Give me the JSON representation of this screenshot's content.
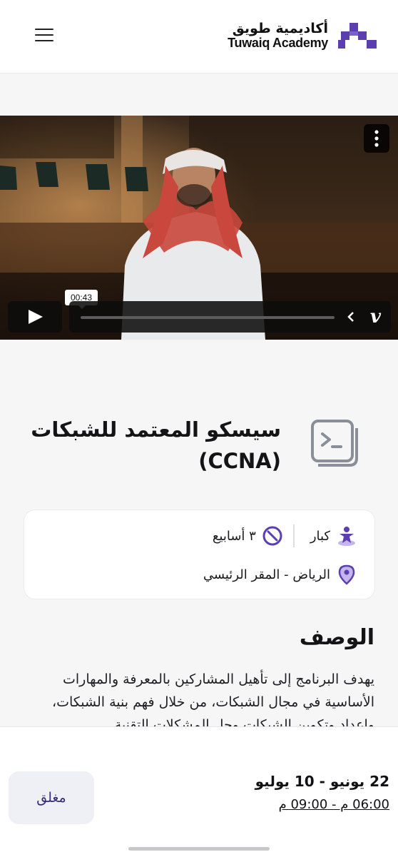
{
  "header": {
    "logo_ar": "أكاديمية طويق",
    "logo_en": "Tuwaiq Academy",
    "brand_color": "#5b3fb0"
  },
  "video": {
    "current_time": "00:43",
    "progress": 0.0,
    "player_brand": "v"
  },
  "course": {
    "title": "سيسكو المعتمد للشبكات (CCNA)"
  },
  "info": {
    "audience": "كبار",
    "duration": "٣ أسابيع",
    "location": "الرياض - المقر الرئيسي"
  },
  "description": {
    "heading": "الوصف",
    "text": "يهدف البرنامج إلى تأهيل المشاركين بالمعرفة والمهارات الأساسية في مجال الشبكات، من خلال فهم بنية الشبكات، وإعداد وتكوين الشبكات وحل المشكلات التقنية"
  },
  "footer": {
    "status_button": "مغلق",
    "date_range": "22 يونيو - 10 يوليو",
    "time_range": "06:00 م - 09:00 م"
  }
}
